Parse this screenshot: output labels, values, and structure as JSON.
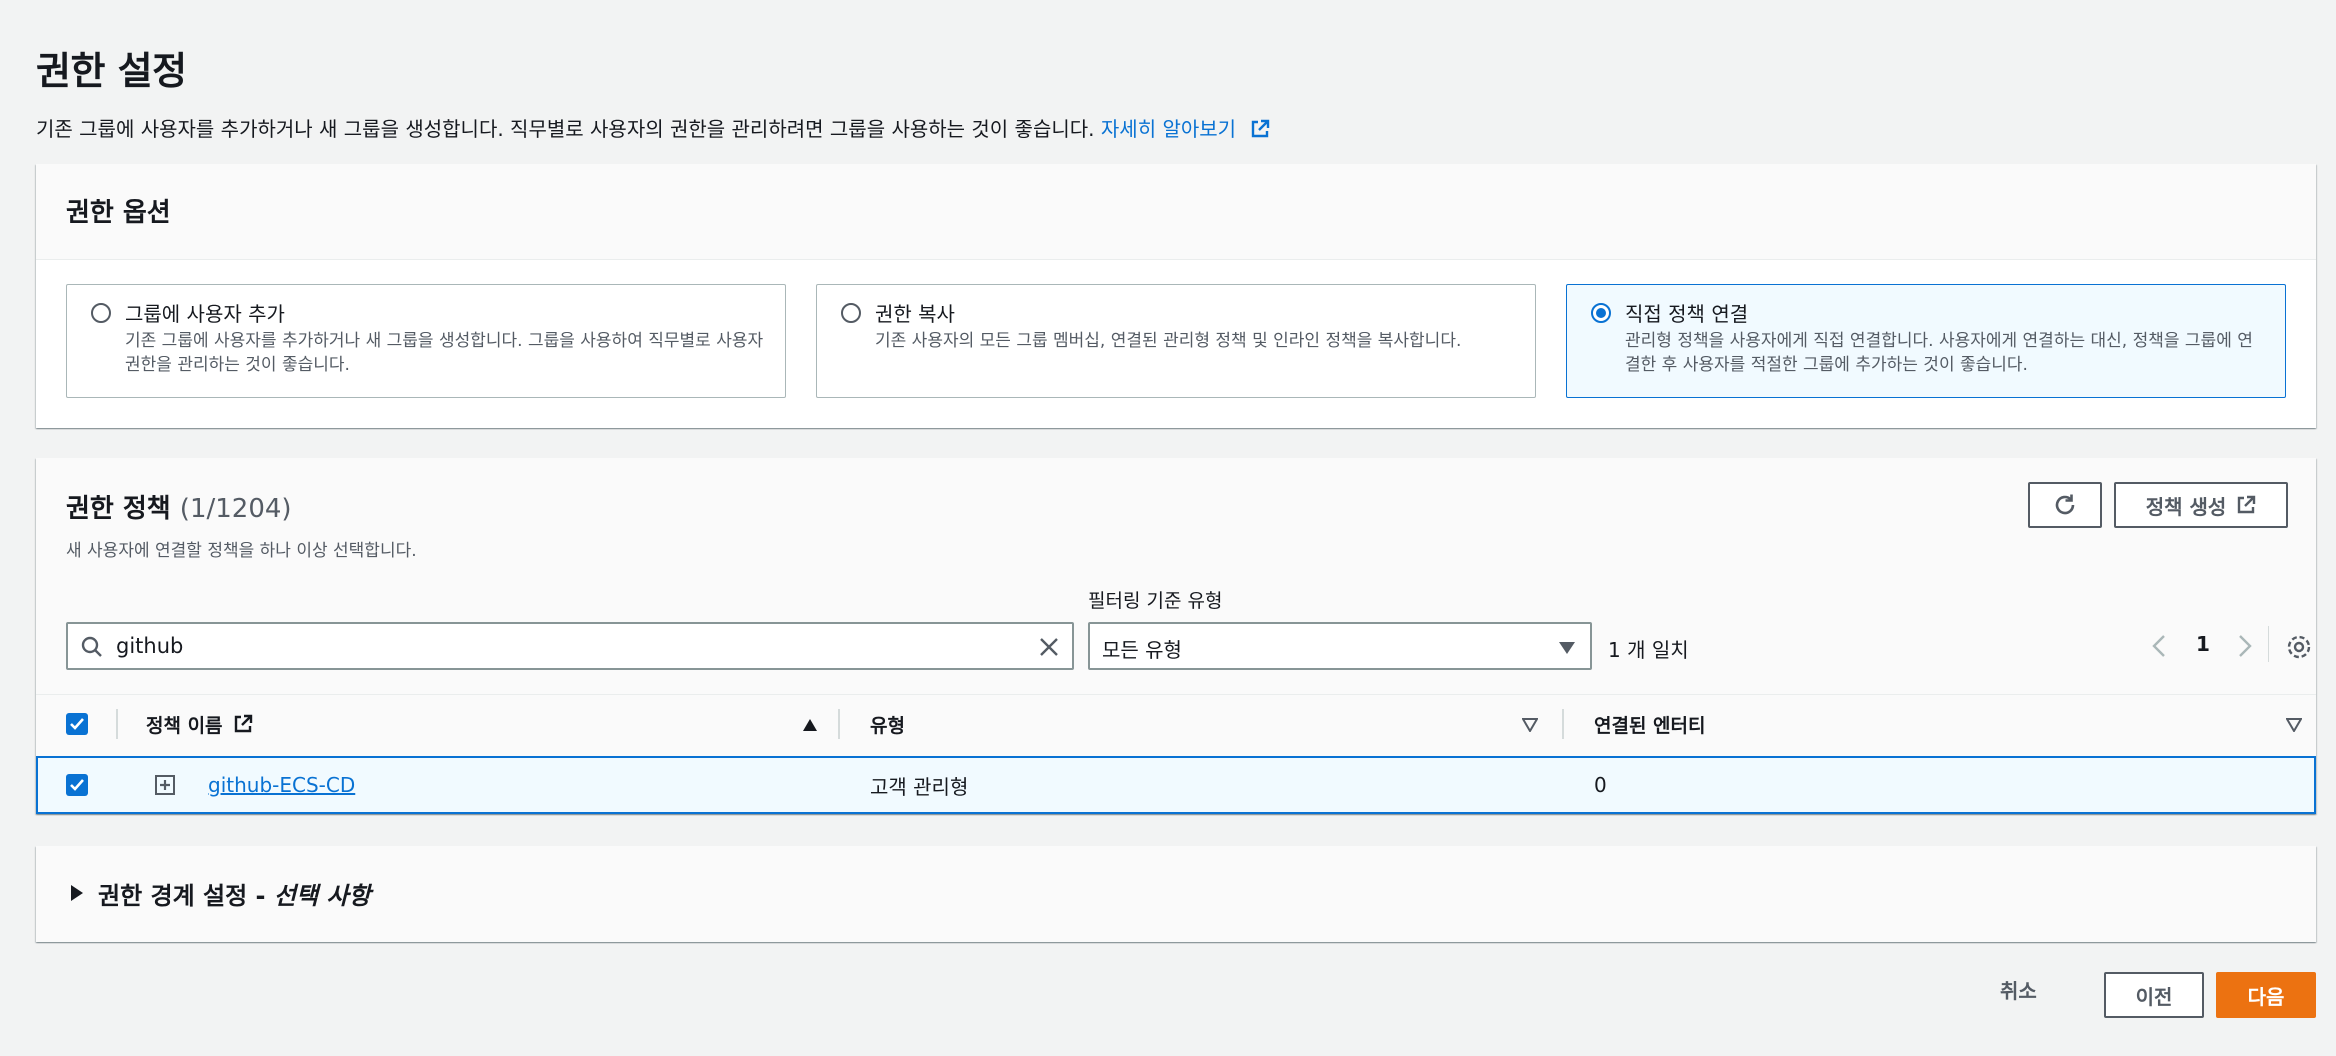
{
  "header": {
    "title": "권한 설정",
    "description": "기존 그룹에 사용자를 추가하거나 새 그룹을 생성합니다. 직무별로 사용자의 권한을 관리하려면 그룹을 사용하는 것이 좋습니다.",
    "learn_more": "자세히 알아보기"
  },
  "options": {
    "title": "권한 옵션",
    "tiles": [
      {
        "title": "그룹에 사용자 추가",
        "desc": "기존 그룹에 사용자를 추가하거나 새 그룹을 생성합니다. 그룹을 사용하여 직무별로 사용자 권한을 관리하는 것이 좋습니다.",
        "selected": false
      },
      {
        "title": "권한 복사",
        "desc": "기존 사용자의 모든 그룹 멤버십, 연결된 관리형 정책 및 인라인 정책을 복사합니다.",
        "selected": false
      },
      {
        "title": "직접 정책 연결",
        "desc": "관리형 정책을 사용자에게 직접 연결합니다. 사용자에게 연결하는 대신, 정책을 그룹에 연결한 후 사용자를 적절한 그룹에 추가하는 것이 좋습니다.",
        "selected": true
      }
    ]
  },
  "policies": {
    "title": "권한 정책",
    "count": "(1/1204)",
    "description": "새 사용자에 연결할 정책을 하나 이상 선택합니다.",
    "create_label": "정책 생성",
    "filter_label": "필터링 기준 유형",
    "search_value": "github",
    "filter_value": "모든 유형",
    "match_count": "1 개 일치",
    "page": "1",
    "columns": {
      "name": "정책 이름",
      "type": "유형",
      "entities": "연결된 엔터티"
    },
    "rows": [
      {
        "name": "github-ECS-CD",
        "type": "고객 관리형",
        "entities": "0"
      }
    ]
  },
  "boundary": {
    "title": "권한 경계 설정 - ",
    "optional": "선택 사항"
  },
  "footer": {
    "cancel": "취소",
    "prev": "이전",
    "next": "다음"
  },
  "colors": {
    "accent": "#0972d3",
    "primary_button": "#ec7211"
  }
}
